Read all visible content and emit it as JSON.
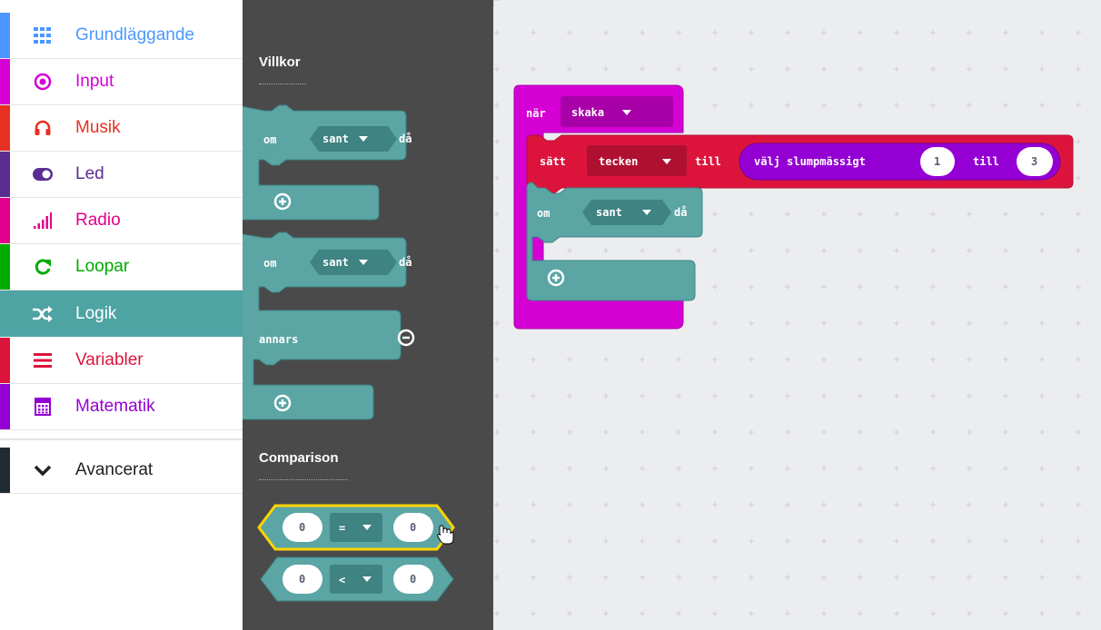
{
  "sidebar": {
    "items": [
      {
        "label": "Grundläggande",
        "color": "#4c97ff",
        "icon": "grid-icon"
      },
      {
        "label": "Input",
        "color": "#d400d4",
        "icon": "target-icon"
      },
      {
        "label": "Musik",
        "color": "#e63022",
        "icon": "headphones-icon"
      },
      {
        "label": "Led",
        "color": "#5c2d91",
        "icon": "toggle-icon"
      },
      {
        "label": "Radio",
        "color": "#e3008c",
        "icon": "signal-bars-icon"
      },
      {
        "label": "Loopar",
        "color": "#00aa00",
        "icon": "refresh-icon"
      },
      {
        "label": "Logik",
        "color": "#4ea3a3",
        "icon": "shuffle-icon",
        "selected": true
      },
      {
        "label": "Variabler",
        "color": "#dc143c",
        "icon": "list-lines-icon"
      },
      {
        "label": "Matematik",
        "color": "#9400d3",
        "icon": "calculator-icon"
      },
      {
        "label": "Avancerat",
        "color": "#1f2d33",
        "icon": "chevron-down-icon"
      }
    ]
  },
  "flyout": {
    "sections": [
      {
        "title": "Villkor"
      },
      {
        "title": "Comparison"
      }
    ],
    "blocks": {
      "if": {
        "om": "om",
        "value": "sant",
        "da": "då"
      },
      "if_else": {
        "om": "om",
        "value": "sant",
        "da": "då",
        "annars": "annars"
      },
      "compare_eq": {
        "left": "0",
        "op": "=",
        "right": "0"
      },
      "compare_lt": {
        "left": "0",
        "op": "<",
        "right": "0"
      }
    }
  },
  "workspace": {
    "event": {
      "label": "när",
      "dropdown": "skaka"
    },
    "set": {
      "label": "sätt",
      "variable": "tecken",
      "to": "till",
      "random_label": "välj slumpmässigt",
      "from": "1",
      "till": "till",
      "to_value": "3"
    },
    "if": {
      "om": "om",
      "value": "sant",
      "da": "då"
    }
  },
  "colors": {
    "logic": "#5ba5a5",
    "logic_dark": "#3f8383",
    "input": "#d400d4",
    "variables": "#dc143c",
    "math": "#9400d3",
    "flyout_bg": "#4a4a4a",
    "workspace_bg": "#ecedef"
  }
}
